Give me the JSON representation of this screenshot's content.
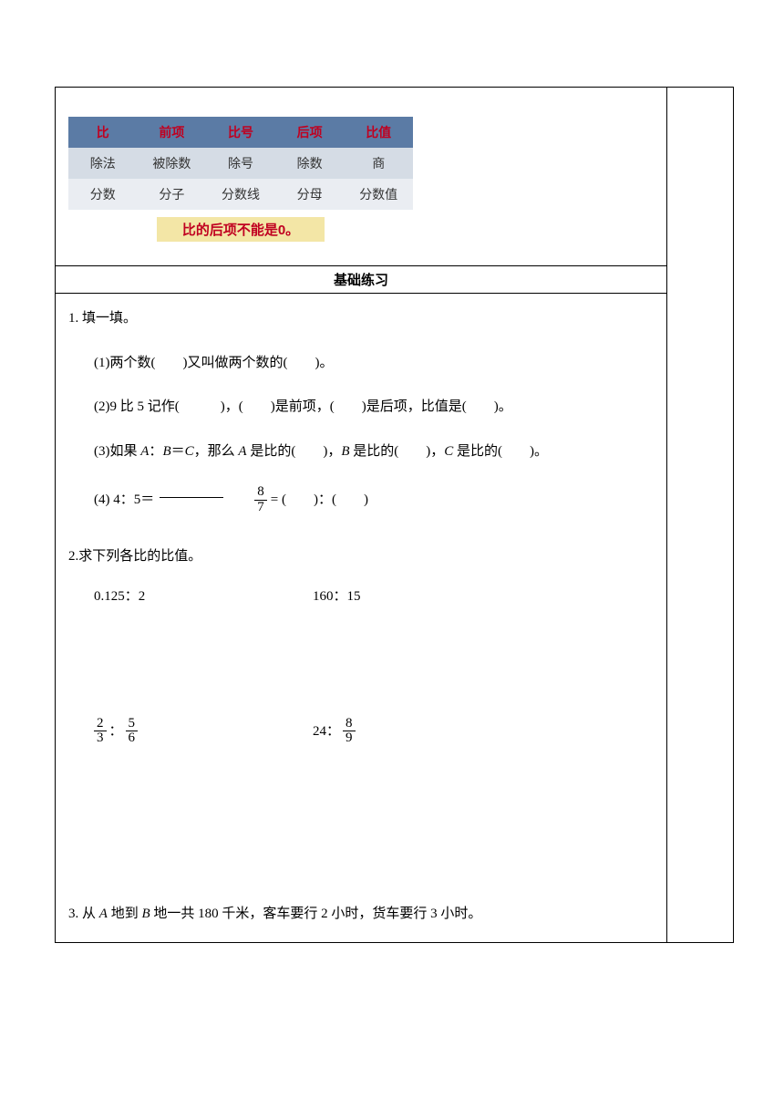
{
  "table": {
    "headers": [
      "比",
      "前项",
      "比号",
      "后项",
      "比值"
    ],
    "row1": [
      "除法",
      "被除数",
      "除号",
      "除数",
      "商"
    ],
    "row2": [
      "分数",
      "分子",
      "分数线",
      "分母",
      "分数值"
    ],
    "note": "比的后项不能是0。"
  },
  "section_title": "基础练习",
  "q1": {
    "stem": "1.  填一填。",
    "s1": "(1)两个数(　　)又叫做两个数的(　　)。",
    "s2": "(2)9 比 5 记作(　　　)，(　　)是前项，(　　)是后项，比值是(　　)。",
    "s3_a": "(3)如果 ",
    "s3_b": "：",
    "s3_c": "＝",
    "s3_d": "，那么 ",
    "s3_e": " 是比的(　　)，",
    "s3_f": " 是比的(　　)，",
    "s3_g": " 是比的(　　)。",
    "A": "A",
    "B": "B",
    "C": "C",
    "s4_a": "(4)  4：5＝",
    "s4_eq": " = (　　)：(　　)",
    "frac_8_7_n": "8",
    "frac_8_7_d": "7"
  },
  "q2": {
    "stem": "2.求下列各比的比值。",
    "a": "0.125：2",
    "b": "160：15",
    "c_n1": "2",
    "c_d1": "3",
    "c_n2": "5",
    "c_d2": "6",
    "d_pre": "24：",
    "d_n": "8",
    "d_d": "9"
  },
  "q3": {
    "text_a": "3.  从 ",
    "text_b": " 地到 ",
    "text_c": " 地一共 180 千米，客车要行 2 小时，货车要行 3 小时。",
    "A": "A",
    "B": "B"
  }
}
